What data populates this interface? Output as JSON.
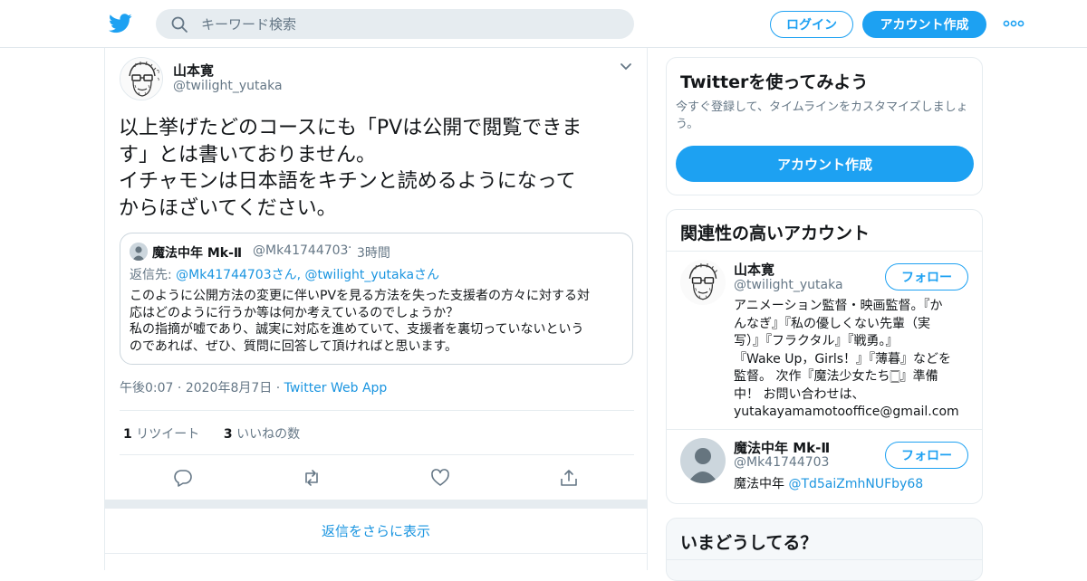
{
  "header": {
    "search_placeholder": "キーワード検索",
    "login_label": "ログイン",
    "signup_label": "アカウント作成",
    "brand_color": "#1da1f2"
  },
  "tweet": {
    "author_name": "山本寛",
    "author_handle": "@twilight_yutaka",
    "text_lines": [
      "以上挙げたどのコースにも「PVは公開で閲覧できま",
      "す」とは書いておりません。",
      "イチャモンは日本語をキチンと読めるようになって",
      "からほざいてください。"
    ],
    "quote": {
      "name": "魔法中年 Mk-Ⅱ",
      "handle": "@Mk41744703",
      "dot": "·",
      "time": "3時間",
      "reply_prefix": "返信先: ",
      "reply_to": "@Mk41744703さん, @twilight_yutakaさん",
      "body_lines": [
        "このように公開方法の変更に伴いPVを見る方法を失った支援者の方々に対する対",
        "応はどのように行うか等は何か考えているのでしょうか？",
        "私の指摘が嘘であり、誠実に対応を進めていて、支援者を裏切っていないという",
        "のであれば、ぜひ、質問に回答して頂ければと思います。"
      ]
    },
    "time": "午後0:07",
    "dot": "·",
    "date": "2020年8月7日",
    "source": "Twitter Web App",
    "retweet_count": "1",
    "retweet_label": "リツイート",
    "like_count": "3",
    "like_label": "いいねの数",
    "more_replies_label": "返信をさらに表示"
  },
  "sidebar": {
    "signup_card": {
      "title": "Twitterを使ってみよう",
      "description": "今すぐ登録して、タイムラインをカスタマイズしましょう。",
      "button_label": "アカウント作成"
    },
    "related": {
      "title": "関連性の高いアカウント",
      "follow_label": "フォロー",
      "accounts": [
        {
          "name": "山本寛",
          "handle": "@twilight_yutaka",
          "bio_lines": [
            "アニメーション監督・映画監督。『か",
            "んなぎ』『私の優しくない先輩（実",
            "写）』『フラクタル』『戦勇。』",
            "『Wake Up，Girls！』『薄暮』などを",
            "監督。 次作『魔法少女たち🀆』準備",
            "中！ お問い合わせは、",
            "yutakayamamotooffice@gmail.com"
          ]
        },
        {
          "name": "魔法中年 Mk-Ⅱ",
          "handle": "@Mk41744703",
          "bio_text": "魔法中年 ",
          "bio_link": "@Td5aiZmhNUFby68"
        }
      ]
    },
    "trends": {
      "title": "いまどうしてる？"
    }
  }
}
